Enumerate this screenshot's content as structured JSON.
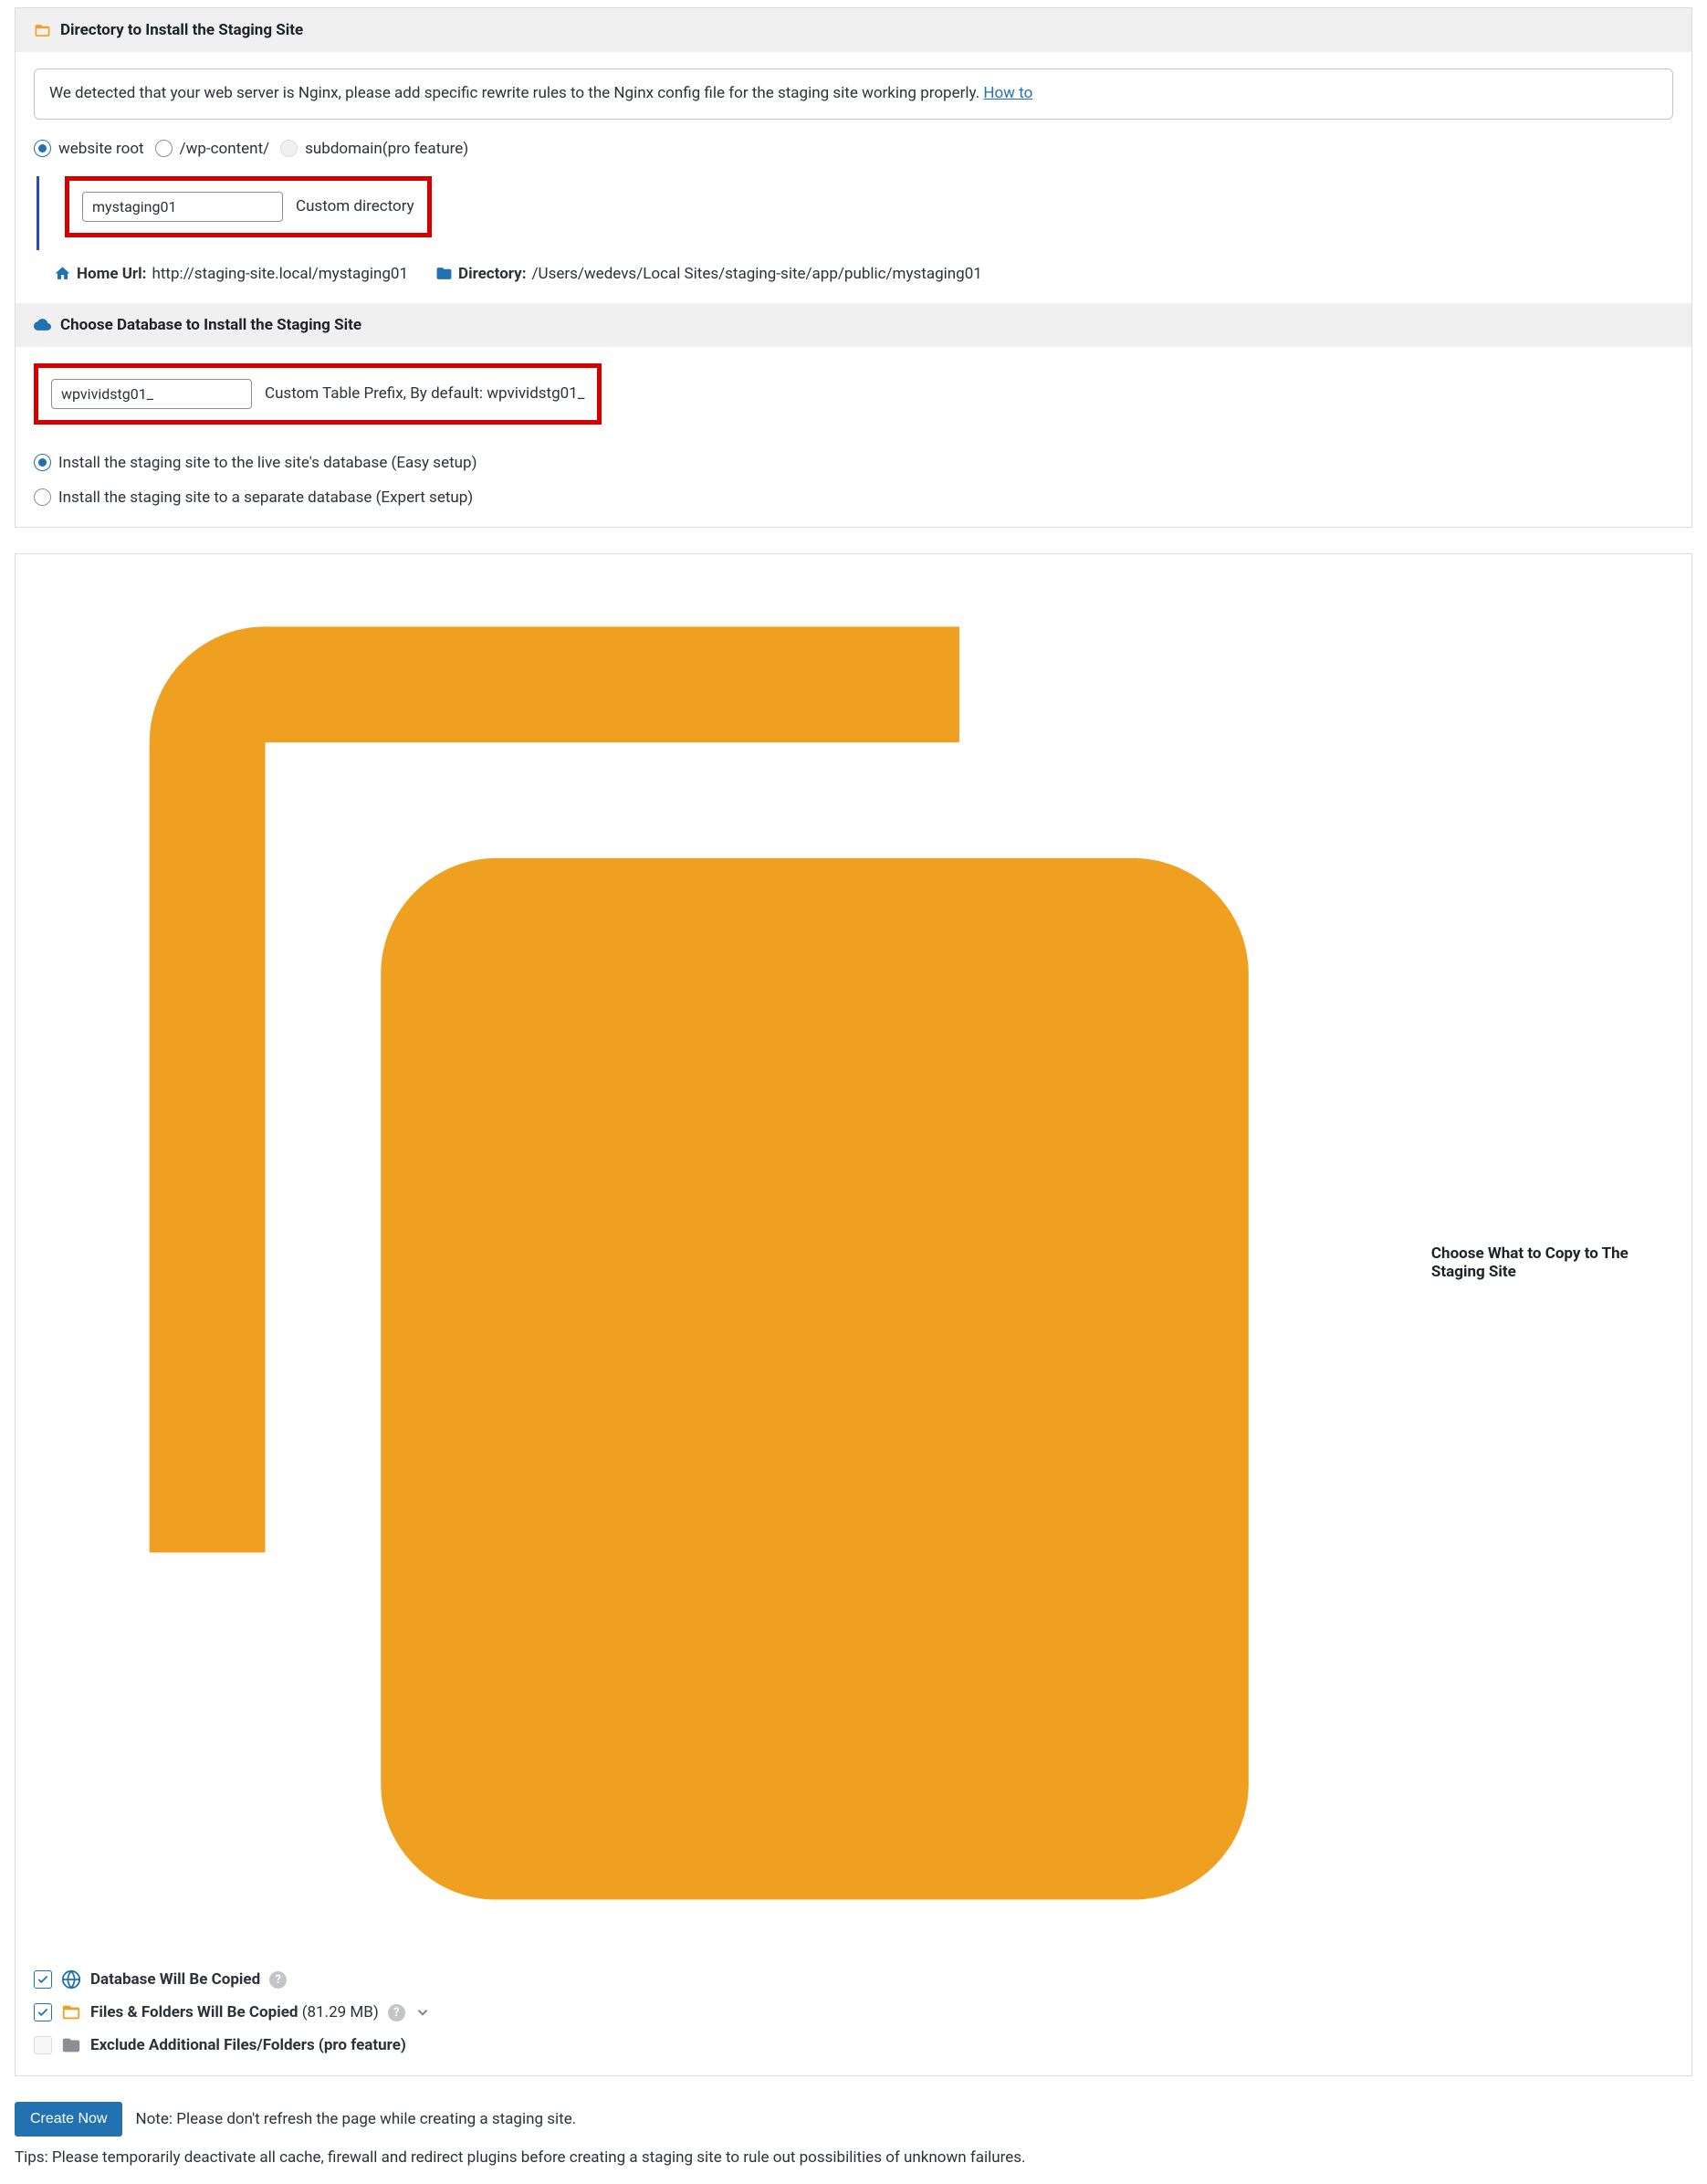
{
  "section_directory": {
    "title": "Directory to Install the Staging Site",
    "notice_text": "We detected that your web server is Nginx, please add specific rewrite rules to the Nginx config file for the staging site working properly. ",
    "notice_link": "How to",
    "radios": {
      "website_root": "website root",
      "wp_content": "/wp-content/",
      "subdomain": "subdomain(pro feature)"
    },
    "directory_input": "mystaging01",
    "directory_hint": "Custom directory",
    "home_url_label": "Home Url:",
    "home_url_value": "http://staging-site.local/mystaging01",
    "directory_label": "Directory:",
    "directory_value": "/Users/wedevs/Local Sites/staging-site/app/public/mystaging01"
  },
  "section_database": {
    "title": "Choose Database to Install the Staging Site",
    "prefix_input": "wpvividstg01_",
    "prefix_hint": "Custom Table Prefix, By default: wpvividstg01_",
    "radios": {
      "easy": "Install the staging site to the live site's database (Easy setup)",
      "expert": "Install the staging site to a separate database (Expert setup)"
    }
  },
  "section_copy": {
    "title": "Choose What to Copy to The Staging Site",
    "items": {
      "database": "Database Will Be Copied",
      "files": "Files & Folders Will Be Copied",
      "files_size": "(81.29 MB)",
      "exclude": "Exclude Additional Files/Folders (pro feature)"
    }
  },
  "footer": {
    "button": "Create Now",
    "note": "Note: Please don't refresh the page while creating a staging site.",
    "tips": "Tips: Please temporarily deactivate all cache, firewall and redirect plugins before creating a staging site to rule out possibilities of unknown failures."
  }
}
